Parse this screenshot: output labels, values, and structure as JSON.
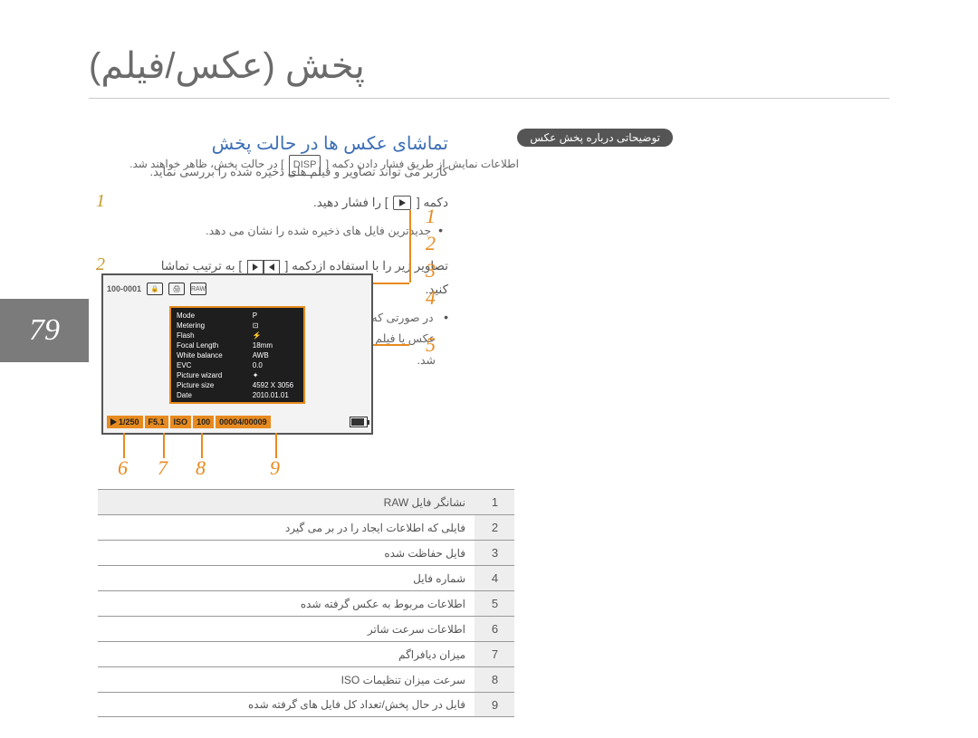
{
  "page": {
    "title": "پخش (عکس/فیلم)",
    "number": "79",
    "subhead": "تماشای عکس ها در حالت پخش",
    "intro": "کاربر می تواند تصاویر و فیلم های ذخیره شده را بررسی نماید.",
    "steps": [
      {
        "num": "1",
        "text_before_icon": "دکمه [",
        "text_after_icon": "] را فشار دهید.",
        "sub": "جدیدترین فایل های ذخیره شده را نشان می دهد."
      },
      {
        "num": "2",
        "text_line1_a": "تصاویر زیر را با استفاده ازدکمه [",
        "text_line1_b": "] به ترتیب تماشا",
        "text_line2": "کنید.",
        "sub_a": "در صورتی که صفحه پخش بیش از یکبار انتخاب شود،",
        "sub_b": "عکس یا فیلم نمایش یافته در آخرین نوبت پخش، مجدداً پخش خواهد شد."
      }
    ],
    "note_bar": "توضیحاتی درباره پخش عکس",
    "note_body_a": "اطلاعات نمایش از طریق فشار دادن دکمه [",
    "note_body_b": "] در حالت پخش، ظاهر خواهند شد.",
    "disp_label": "DISP"
  },
  "lcd": {
    "top_counter": "100-0001",
    "info_rows": [
      [
        "Mode",
        "P"
      ],
      [
        "Metering",
        "⊡"
      ],
      [
        "Flash",
        "⚡"
      ],
      [
        "Focal Length",
        "18mm"
      ],
      [
        "White balance",
        "AWB"
      ],
      [
        "EVC",
        "0.0"
      ],
      [
        "Picture wizard",
        "✦"
      ],
      [
        "Picture size",
        "4592 X 3056"
      ],
      [
        "Date",
        "2010.01.01"
      ]
    ],
    "bottom": {
      "shutter": "1/250",
      "aperture": "F5.1",
      "iso_label": "ISO",
      "iso_value": "100",
      "counter": "00004/00009"
    }
  },
  "callouts": {
    "right": [
      "1",
      "2",
      "3",
      "4",
      "5"
    ],
    "bottom": [
      "6",
      "7",
      "8",
      "9"
    ]
  },
  "legend": [
    {
      "n": "1",
      "t": "نشانگر فایل RAW"
    },
    {
      "n": "2",
      "t": "فایلی که اطلاعات ایجاد را در بر می گیرد"
    },
    {
      "n": "3",
      "t": "فایل حفاظت شده"
    },
    {
      "n": "4",
      "t": "شماره فایل"
    },
    {
      "n": "5",
      "t": "اطلاعات مربوط به عکس گرفته شده"
    },
    {
      "n": "6",
      "t": "اطلاعات سرعت شاتر"
    },
    {
      "n": "7",
      "t": "میزان دیافراگم"
    },
    {
      "n": "8",
      "t": "سرعت میزان تنظیمات ISO"
    },
    {
      "n": "9",
      "t": "فایل در حال پخش/تعداد کل فایل های گرفته شده"
    }
  ]
}
